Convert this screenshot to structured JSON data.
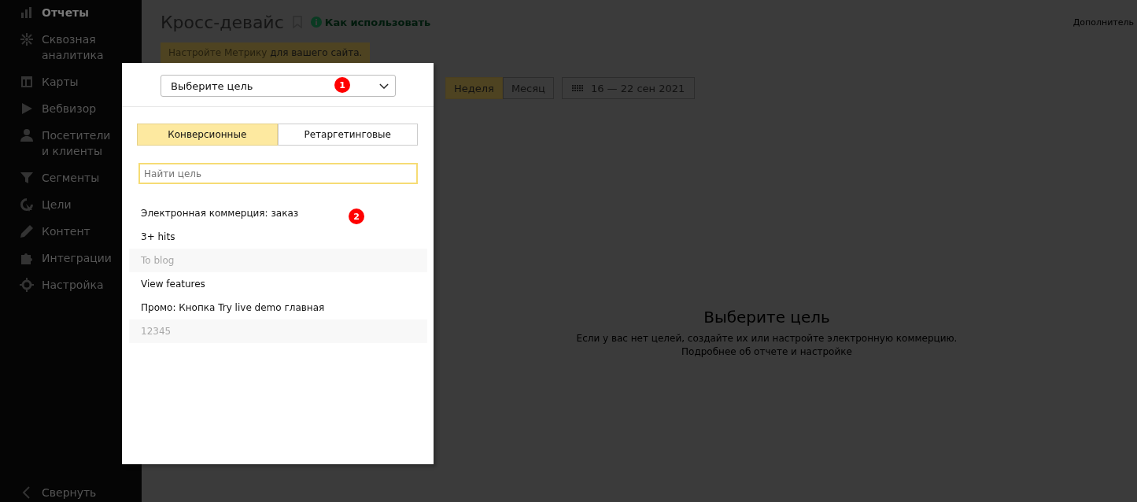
{
  "sidebar": {
    "items": [
      {
        "label": "Отчеты",
        "selected": true
      },
      {
        "label": "Сквозная аналитика",
        "selected": false
      },
      {
        "label": "Карты",
        "selected": false
      },
      {
        "label": "Вебвизор",
        "selected": false
      },
      {
        "label": "Посетители и клиенты",
        "selected": false
      },
      {
        "label": "Сегменты",
        "selected": false
      },
      {
        "label": "Цели",
        "selected": false
      },
      {
        "label": "Контент",
        "selected": false
      },
      {
        "label": "Интеграции",
        "selected": false
      },
      {
        "label": "Настройка",
        "selected": false
      }
    ],
    "collapse": "Свернуть"
  },
  "header": {
    "title": "Кросс-девайс",
    "help_link": "Как использовать",
    "extra": "Дополнитель"
  },
  "notice": {
    "link": "Настройте Метрику",
    "text": " для вашего сайта."
  },
  "toolbar": {
    "goal_select": "Выберите цель",
    "periods": [
      {
        "label": "Неделя",
        "selected": true
      },
      {
        "label": "Месяц",
        "selected": false
      }
    ],
    "date_range": "16 — 22 сен 2021"
  },
  "dropdown": {
    "tabs": [
      {
        "label": "Конверсионные",
        "selected": true
      },
      {
        "label": "Ретаргетинговые",
        "selected": false
      }
    ],
    "search": {
      "placeholder": "Найти цель"
    },
    "goals": [
      {
        "label": "Электронная коммерция: заказ",
        "disabled": false
      },
      {
        "label": "3+ hits",
        "disabled": false
      },
      {
        "label": "To blog",
        "disabled": true
      },
      {
        "label": "View features",
        "disabled": false
      },
      {
        "label": "Промо: Кнопка Try live demo главная",
        "disabled": false
      },
      {
        "label": "12345",
        "disabled": true
      }
    ]
  },
  "markers": [
    "1",
    "2"
  ],
  "empty_state": {
    "title": "Выберите цель",
    "text": "Если у вас нет целей, создайте их или настройте электронную коммерцию.",
    "link": "Подробнее об отчете и настройке"
  }
}
